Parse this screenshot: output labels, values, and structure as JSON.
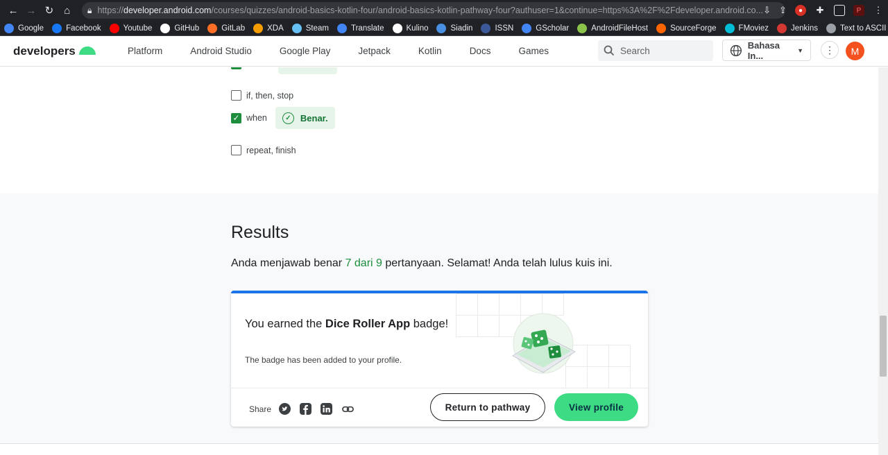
{
  "browser": {
    "url_prefix": "https://",
    "url_host": "developer.android.com",
    "url_rest": "/courses/quizzes/android-basics-kotlin-four/android-basics-kotlin-pathway-four?authuser=1&continue=https%3A%2F%2Fdeveloper.android.co..."
  },
  "bookmarks": [
    {
      "label": "Google",
      "color": "#4285f4"
    },
    {
      "label": "Facebook",
      "color": "#1877f2"
    },
    {
      "label": "Youtube",
      "color": "#ff0000"
    },
    {
      "label": "GitHub",
      "color": "#ffffff"
    },
    {
      "label": "GitLab",
      "color": "#fc6d26"
    },
    {
      "label": "XDA",
      "color": "#f59c00"
    },
    {
      "label": "Steam",
      "color": "#66c0f4"
    },
    {
      "label": "Translate",
      "color": "#4285f4"
    },
    {
      "label": "Kulino",
      "color": "#ffffff"
    },
    {
      "label": "Siadin",
      "color": "#4a90e2"
    },
    {
      "label": "ISSN",
      "color": "#3b5998"
    },
    {
      "label": "GScholar",
      "color": "#4285f4"
    },
    {
      "label": "AndroidFileHost",
      "color": "#8bc34a"
    },
    {
      "label": "SourceForge",
      "color": "#ff6600"
    },
    {
      "label": "FMoviez",
      "color": "#00bcd4"
    },
    {
      "label": "Jenkins",
      "color": "#d33833"
    },
    {
      "label": "Text to ASCII",
      "color": "#9aa0a6"
    }
  ],
  "header": {
    "logo": "developers",
    "nav": [
      "Platform",
      "Android Studio",
      "Google Play",
      "Jetpack",
      "Kotlin",
      "Docs",
      "Games"
    ],
    "search_placeholder": "Search",
    "language": "Bahasa In...",
    "avatar_letter": "M"
  },
  "quiz": {
    "options": [
      {
        "label": "if, then, stop",
        "checked": false
      },
      {
        "label": "when",
        "checked": true,
        "feedback": "Benar."
      },
      {
        "label": "repeat, finish",
        "checked": false
      }
    ]
  },
  "results": {
    "heading": "Results",
    "summary_before": "Anda menjawab benar ",
    "score": "7 dari 9",
    "summary_after": " pertanyaan. Selamat! Anda telah lulus kuis ini.",
    "badge_text_before": "You earned the ",
    "badge_name": "Dice Roller App",
    "badge_text_after": " badge!",
    "badge_added": "The badge has been added to your profile.",
    "share_label": "Share",
    "return_button": "Return to pathway",
    "view_button": "View profile"
  },
  "colors": {
    "accent_green": "#3ddc84",
    "correct_green": "#1e8e3e",
    "card_top_blue": "#1a73e8"
  }
}
